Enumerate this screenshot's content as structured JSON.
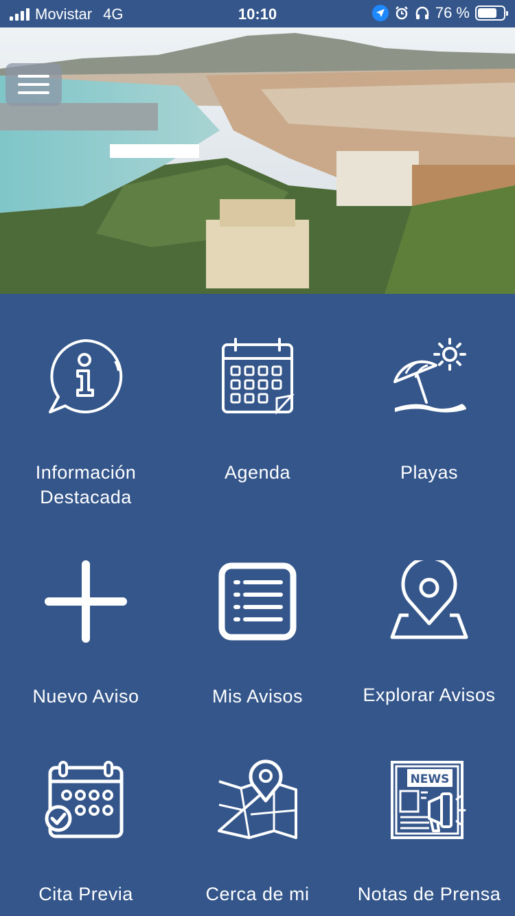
{
  "status_bar": {
    "carrier": "Movistar",
    "network": "4G",
    "time": "10:10",
    "battery_text": "76 %",
    "battery_level": 0.76
  },
  "header": {
    "menu_icon": "hamburger-icon",
    "hero_image": "city-panorama-photo"
  },
  "tiles": [
    {
      "label_line1": "Información",
      "label_line2": "Destacada",
      "icon": "info-bubble-icon"
    },
    {
      "label": "Agenda",
      "icon": "calendar-icon"
    },
    {
      "label": "Playas",
      "icon": "beach-umbrella-icon"
    },
    {
      "label": "Nuevo Aviso",
      "icon": "plus-icon"
    },
    {
      "label": "Mis Avisos",
      "icon": "list-icon"
    },
    {
      "label": "Explorar Avisos",
      "icon": "map-pin-icon"
    },
    {
      "label": "Cita Previa",
      "icon": "calendar-check-icon"
    },
    {
      "label": "Cerca de mi",
      "icon": "map-location-icon"
    },
    {
      "label": "Notas de Prensa",
      "icon": "newspaper-icon"
    }
  ],
  "colors": {
    "background": "#34568b",
    "foreground": "#ffffff",
    "location_accent": "#1e88ff"
  }
}
